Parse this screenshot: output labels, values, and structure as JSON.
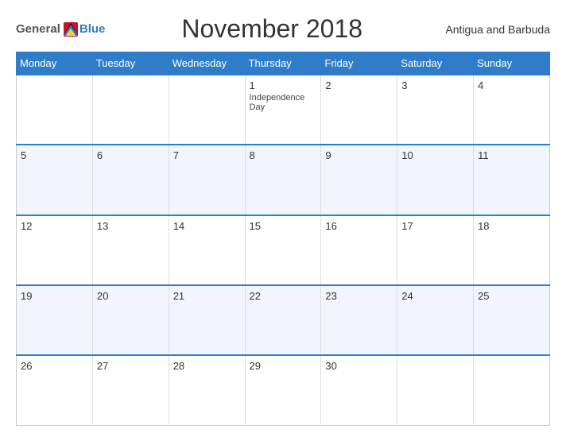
{
  "header": {
    "logo": {
      "general": "General",
      "blue": "Blue"
    },
    "title": "November 2018",
    "country": "Antigua and Barbuda"
  },
  "calendar": {
    "days_of_week": [
      "Monday",
      "Tuesday",
      "Wednesday",
      "Thursday",
      "Friday",
      "Saturday",
      "Sunday"
    ],
    "weeks": [
      [
        {
          "day": "",
          "empty": true
        },
        {
          "day": "",
          "empty": true
        },
        {
          "day": "",
          "empty": true
        },
        {
          "day": "1",
          "event": "Independence Day"
        },
        {
          "day": "2"
        },
        {
          "day": "3"
        },
        {
          "day": "4"
        }
      ],
      [
        {
          "day": "5"
        },
        {
          "day": "6"
        },
        {
          "day": "7"
        },
        {
          "day": "8"
        },
        {
          "day": "9"
        },
        {
          "day": "10"
        },
        {
          "day": "11"
        }
      ],
      [
        {
          "day": "12"
        },
        {
          "day": "13"
        },
        {
          "day": "14"
        },
        {
          "day": "15"
        },
        {
          "day": "16"
        },
        {
          "day": "17"
        },
        {
          "day": "18"
        }
      ],
      [
        {
          "day": "19"
        },
        {
          "day": "20"
        },
        {
          "day": "21"
        },
        {
          "day": "22"
        },
        {
          "day": "23"
        },
        {
          "day": "24"
        },
        {
          "day": "25"
        }
      ],
      [
        {
          "day": "26"
        },
        {
          "day": "27"
        },
        {
          "day": "28"
        },
        {
          "day": "29"
        },
        {
          "day": "30"
        },
        {
          "day": "",
          "empty": true
        },
        {
          "day": "",
          "empty": true
        }
      ]
    ]
  }
}
